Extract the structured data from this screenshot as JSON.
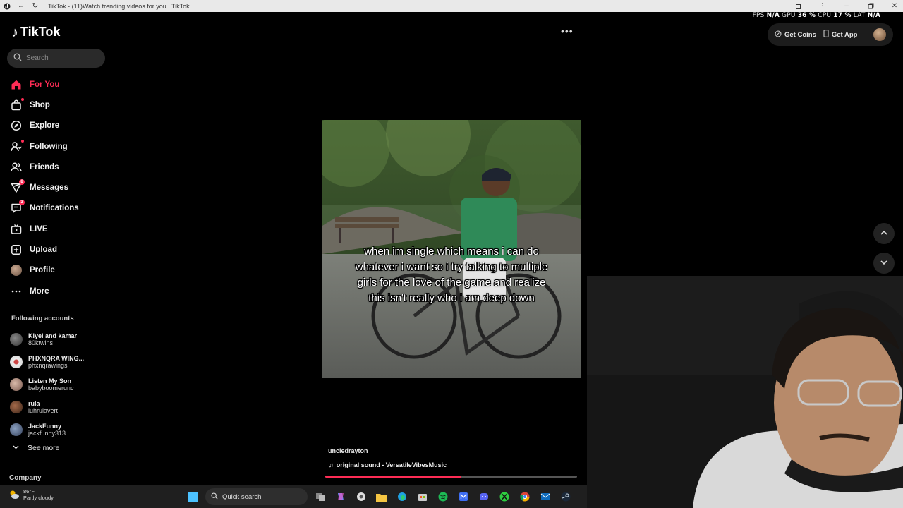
{
  "browser": {
    "tab_title": "TikTok - (11)Watch trending videos for you | TikTok"
  },
  "perf": {
    "fps_label": "FPS",
    "fps_value": "N/A",
    "gpu_label": "GPU",
    "gpu_value": "36 %",
    "cpu_label": "CPU",
    "cpu_value": "17 %",
    "lat_label": "LAT",
    "lat_value": "N/A"
  },
  "logo": {
    "text": "TikTok"
  },
  "search": {
    "placeholder": "Search"
  },
  "nav": {
    "items": [
      {
        "label": "For You",
        "icon": "home-icon"
      },
      {
        "label": "Shop",
        "icon": "shop-icon"
      },
      {
        "label": "Explore",
        "icon": "compass-icon"
      },
      {
        "label": "Following",
        "icon": "following-icon"
      },
      {
        "label": "Friends",
        "icon": "friends-icon"
      },
      {
        "label": "Messages",
        "icon": "messages-icon",
        "badge": "8"
      },
      {
        "label": "Notifications",
        "icon": "notifications-icon",
        "badge": "3"
      },
      {
        "label": "LIVE",
        "icon": "live-icon"
      },
      {
        "label": "Upload",
        "icon": "upload-icon"
      },
      {
        "label": "Profile",
        "icon": "avatar"
      },
      {
        "label": "More",
        "icon": "more-icon"
      }
    ]
  },
  "following": {
    "title": "Following accounts",
    "accounts": [
      {
        "name": "Kiyel and kamar",
        "user": "80ktwins"
      },
      {
        "name": "PHXNQRA WING...",
        "user": "phxnqrawings"
      },
      {
        "name": "Listen My Son",
        "user": "babyboomerunc"
      },
      {
        "name": "rula",
        "user": "luhrulavert"
      },
      {
        "name": "JackFunny",
        "user": "jackfunny313"
      }
    ],
    "see_more": "See more"
  },
  "company": "Company",
  "header": {
    "get_coins": "Get Coins",
    "get_app": "Get App"
  },
  "video": {
    "caption": "when im single which means i can do whatever i want so i try talking to multiple girls for the love of the game and realize this isn't really who i am deep down",
    "username": "uncledrayton",
    "sound": "original sound - VersatileVibesMusic",
    "progress": 0.54
  },
  "taskbar": {
    "temperature": "86°F",
    "condition": "Partly cloudy",
    "search_label": "Quick search"
  },
  "colors": {
    "accent": "#fe2c55",
    "background": "#000000",
    "sidebar_text": "#f1f1f1"
  }
}
